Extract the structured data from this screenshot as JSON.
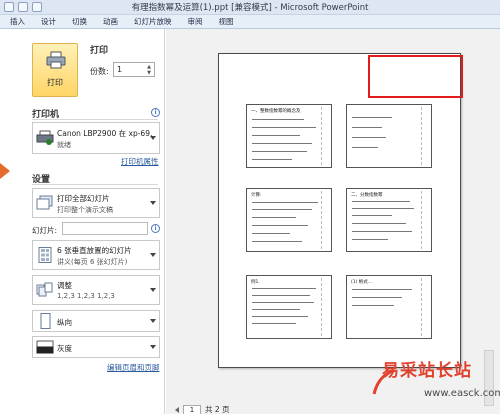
{
  "window": {
    "title": "有理指数幂及运算(1).ppt [兼容模式] - Microsoft PowerPoint"
  },
  "ribbon": {
    "tabs": [
      "插入",
      "设计",
      "切换",
      "动画",
      "幻灯片放映",
      "审阅",
      "视图"
    ]
  },
  "print": {
    "button_label": "打印",
    "heading": "打印",
    "copies_label": "份数:",
    "copies_value": "1"
  },
  "printer": {
    "heading": "打印机",
    "name": "Canon LBP2900 在 xp-69...",
    "status": "就绪",
    "properties_link": "打印机属性"
  },
  "settings": {
    "heading": "设置",
    "range": {
      "title": "打印全部幻灯片",
      "subtitle": "打印整个演示文稿"
    },
    "slides_label": "幻灯片:",
    "layout": {
      "title": "6 张垂直放置的幻灯片",
      "subtitle": "讲义(每页 6 张幻灯片)"
    },
    "collate": {
      "title": "调整",
      "subtitle": "1,2,3    1,2,3    1,2,3"
    },
    "orientation": {
      "title": "纵向"
    },
    "color": {
      "title": "灰度"
    },
    "header_footer_link": "编辑页眉和页脚"
  },
  "preview": {
    "page_current": "1",
    "page_total": "共 2 页",
    "slide_titles": [
      "一、整数指数幂的概念及",
      "计算:",
      "例1.",
      "二、分数指数幂",
      "(2) 当...",
      "(1) 根式..."
    ]
  },
  "watermark": {
    "brand": "易采站长站",
    "url": "www.easck.com"
  },
  "colors": {
    "accent_orange": "#e66a2c",
    "highlight_red": "#e21b1b",
    "print_button": "#ffd565"
  }
}
